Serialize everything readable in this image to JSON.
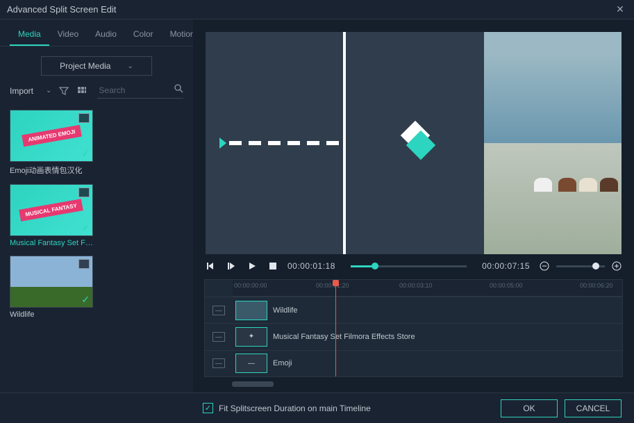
{
  "window": {
    "title": "Advanced Split Screen Edit"
  },
  "tabs": [
    "Media",
    "Video",
    "Audio",
    "Color",
    "Motion"
  ],
  "active_tab": 0,
  "dropdown": {
    "label": "Project Media"
  },
  "import_label": "Import",
  "search": {
    "placeholder": "Search"
  },
  "media_items": [
    {
      "label": "Emoji动画表情包汉化",
      "ribbon": "ANIMATED EMOJI"
    },
    {
      "label": "Musical Fantasy Set  Film...",
      "ribbon": "MUSICAL FANTASY",
      "accent": true
    },
    {
      "label": "Wildlife",
      "wildlife": true
    }
  ],
  "transport": {
    "current_time": "00:00:01:18",
    "total_time": "00:00:07:15"
  },
  "ruler_ticks": [
    {
      "t": "00:00:00:00",
      "pos": 0
    },
    {
      "t": "00:00:01:20",
      "pos": 120
    },
    {
      "t": "00:00:03:10",
      "pos": 240
    },
    {
      "t": "00:00:05:00",
      "pos": 370
    },
    {
      "t": "00:00:06:20",
      "pos": 500
    }
  ],
  "tracks": [
    {
      "label": "Wildlife"
    },
    {
      "label": "Musical Fantasy Set  Filmora Effects Store"
    },
    {
      "label": "Emoji"
    }
  ],
  "footer": {
    "checkbox_label": "Fit Splitscreen Duration on main Timeline",
    "ok": "OK",
    "cancel": "CANCEL"
  },
  "icons": {
    "close": "✕",
    "chevron": "⌄",
    "filter": "▽",
    "grid": "⊞",
    "search": "🔍",
    "prev": "◂▮",
    "step": "▮▸",
    "play": "▶",
    "stop": "■",
    "zoom_out": "⊖",
    "zoom_in": "⊕",
    "check": "✓",
    "star": "✦"
  }
}
